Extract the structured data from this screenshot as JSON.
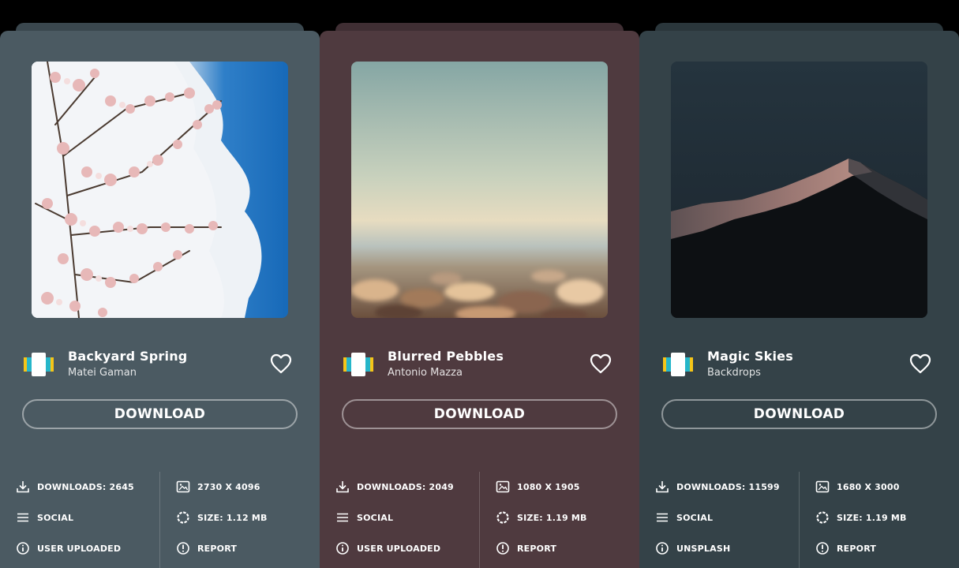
{
  "cards": [
    {
      "title": "Backyard Spring",
      "author": "Matei Gaman",
      "download_label": "DOWNLOAD",
      "downloads": "DOWNLOADS: 2645",
      "resolution": "2730 X 4096",
      "category": "SOCIAL",
      "size": "SIZE: 1.12 MB",
      "source": "USER UPLOADED",
      "report": "REPORT",
      "bg_color": "#4b5a62",
      "stack_color": "#3a474e"
    },
    {
      "title": "Blurred Pebbles",
      "author": "Antonio Mazza",
      "download_label": "DOWNLOAD",
      "downloads": "DOWNLOADS: 2049",
      "resolution": "1080 X 1905",
      "category": "SOCIAL",
      "size": "SIZE: 1.19 MB",
      "source": "USER UPLOADED",
      "report": "REPORT",
      "bg_color": "#4f3a3f",
      "stack_color": "#3f2e33"
    },
    {
      "title": "Magic Skies",
      "author": "Backdrops",
      "download_label": "DOWNLOAD",
      "downloads": "DOWNLOADS: 11599",
      "resolution": "1680 X 3000",
      "category": "SOCIAL",
      "size": "SIZE: 1.19 MB",
      "source": "UNSPLASH",
      "report": "REPORT",
      "bg_color": "#344248",
      "stack_color": "#2a363b"
    }
  ],
  "icons": {
    "downloads": "download-icon",
    "resolution": "image-icon",
    "category": "menu-icon",
    "size": "size-ring-icon",
    "source": "info-icon",
    "report": "alert-icon",
    "favorite": "heart-icon",
    "app": "wallpaper-app-icon"
  }
}
